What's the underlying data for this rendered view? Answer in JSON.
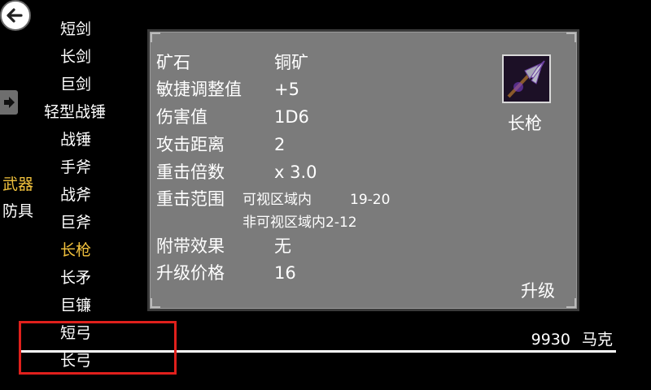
{
  "categories": [
    {
      "label": "武器",
      "active": true
    },
    {
      "label": "防具",
      "active": false
    }
  ],
  "weapon_list": [
    {
      "label": "短剑"
    },
    {
      "label": "长剑"
    },
    {
      "label": "巨剑"
    },
    {
      "label": "轻型战锤"
    },
    {
      "label": "战锤"
    },
    {
      "label": "手斧"
    },
    {
      "label": "战斧"
    },
    {
      "label": "巨斧"
    },
    {
      "label": "长枪",
      "selected": true
    },
    {
      "label": "长矛"
    },
    {
      "label": "巨镰"
    },
    {
      "label": "短弓"
    },
    {
      "label": "长弓"
    }
  ],
  "details": {
    "ore_label": "矿石",
    "ore_value": "铜矿",
    "dex_label": "敏捷调整值",
    "dex_value": "+5",
    "damage_label": "伤害值",
    "damage_value": "1D6",
    "range_label": "攻击距离",
    "range_value": "2",
    "crit_mult_label": "重击倍数",
    "crit_mult_value": "x 3.0",
    "crit_range_label": "重击范围",
    "crit_visible_label": "可视区域内",
    "crit_visible_value": "19-20",
    "crit_invisible_label": "非可视区域内",
    "crit_invisible_value": "2-12",
    "effect_label": "附带效果",
    "effect_value": "无",
    "upgrade_cost_label": "升级价格",
    "upgrade_cost_value": "16"
  },
  "item": {
    "name": "长枪",
    "icon": "spear-icon"
  },
  "upgrade_label": "升级",
  "currency": {
    "amount": "9930",
    "unit": "马克"
  },
  "colors": {
    "accent": "#f2c23d",
    "panel": "#7b7b7b",
    "highlight": "#e0201c"
  }
}
